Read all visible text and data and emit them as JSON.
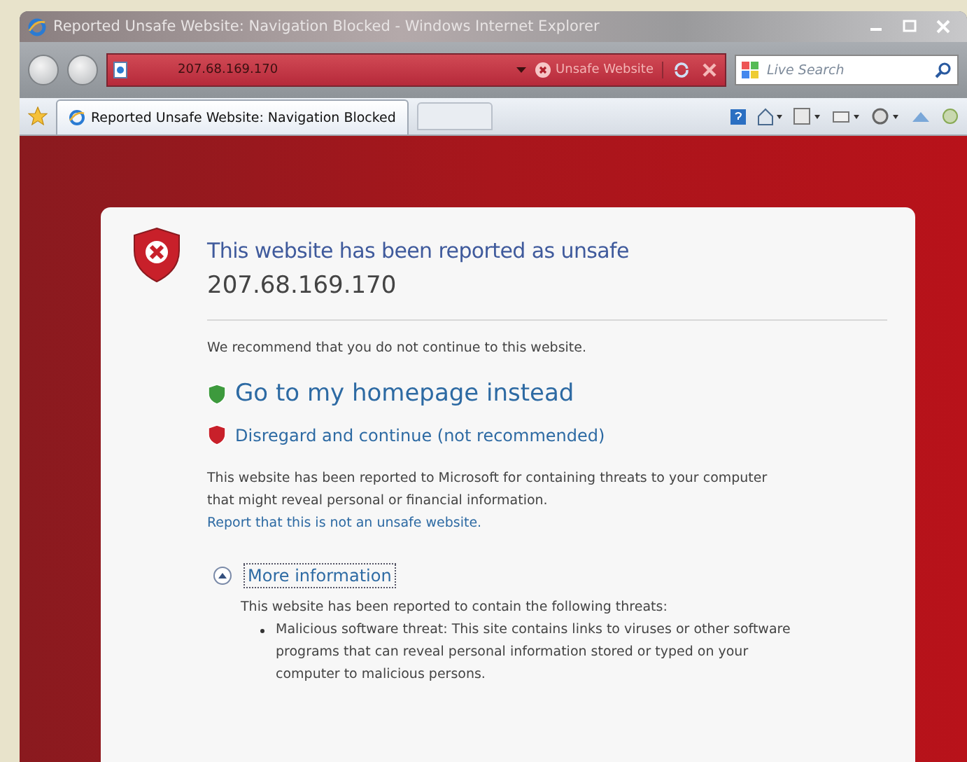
{
  "window": {
    "title": "Reported Unsafe Website: Navigation Blocked - Windows Internet Explorer"
  },
  "address_bar": {
    "url": "207.68.169.170",
    "status": "Unsafe Website"
  },
  "search": {
    "placeholder": "Live Search"
  },
  "tabs": [
    {
      "label": "Reported Unsafe Website: Navigation Blocked",
      "selected": true
    }
  ],
  "warning": {
    "heading": "This website has been reported as unsafe",
    "address": "207.68.169.170",
    "recommendation": "We recommend that you do not continue to this website.",
    "actions": [
      {
        "kind": "safe",
        "label": "Go to my homepage instead"
      },
      {
        "kind": "unsafe",
        "label": "Disregard and continue (not recommended)"
      }
    ],
    "explanation": "This website has been reported to Microsoft for containing threats to your computer that might reveal personal or financial information.",
    "report_link": "Report that this is not an unsafe website.",
    "more_info": {
      "label": "More information",
      "expanded": true,
      "intro": "This website has been reported to contain the following threats:",
      "threats": [
        "Malicious software threat: This site contains links to viruses or other software programs that can reveal personal information stored or typed on your computer to malicious persons."
      ]
    }
  }
}
